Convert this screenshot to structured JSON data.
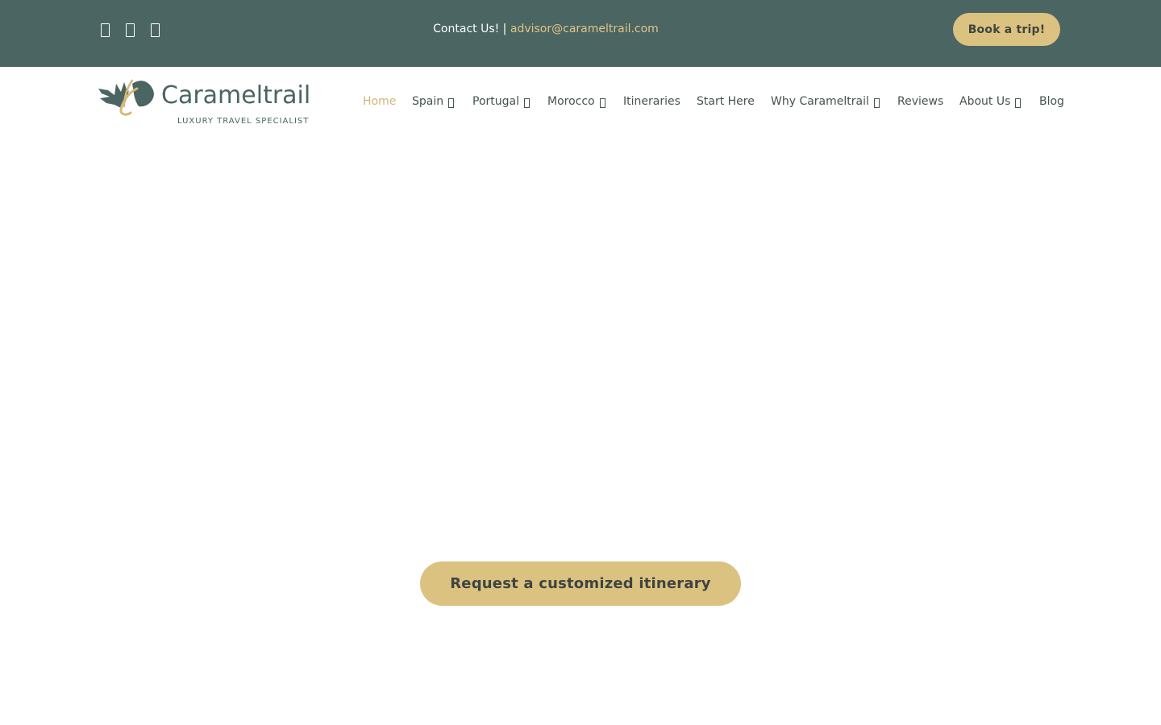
{
  "topbar": {
    "social_icons": [
      "facebook-icon",
      "instagram-icon",
      "pinterest-icon"
    ],
    "contact_label": "Contact Us! | ",
    "contact_email": "advisor@carameltrail.com",
    "book_button": "Book a trip!"
  },
  "logo": {
    "name": "Carameltrail",
    "tagline": "LUXURY TRAVEL SPECIALIST"
  },
  "nav": {
    "items": [
      {
        "label": "Home",
        "active": true,
        "dropdown": false
      },
      {
        "label": "Spain",
        "active": false,
        "dropdown": true
      },
      {
        "label": "Portugal",
        "active": false,
        "dropdown": true
      },
      {
        "label": "Morocco",
        "active": false,
        "dropdown": true
      },
      {
        "label": "Itineraries",
        "active": false,
        "dropdown": false
      },
      {
        "label": "Start Here",
        "active": false,
        "dropdown": false
      },
      {
        "label": "Why Carameltrail",
        "active": false,
        "dropdown": true
      },
      {
        "label": "Reviews",
        "active": false,
        "dropdown": false
      },
      {
        "label": "About Us",
        "active": false,
        "dropdown": true
      },
      {
        "label": "Blog",
        "active": false,
        "dropdown": false
      }
    ]
  },
  "hero": {
    "cta_label": "Request a customized itinerary"
  },
  "colors": {
    "topbar_bg": "#4a6562",
    "accent_gold": "#dcc281",
    "link_gold": "#e0c585",
    "nav_text": "#445451",
    "logo_green": "#4a6562"
  }
}
